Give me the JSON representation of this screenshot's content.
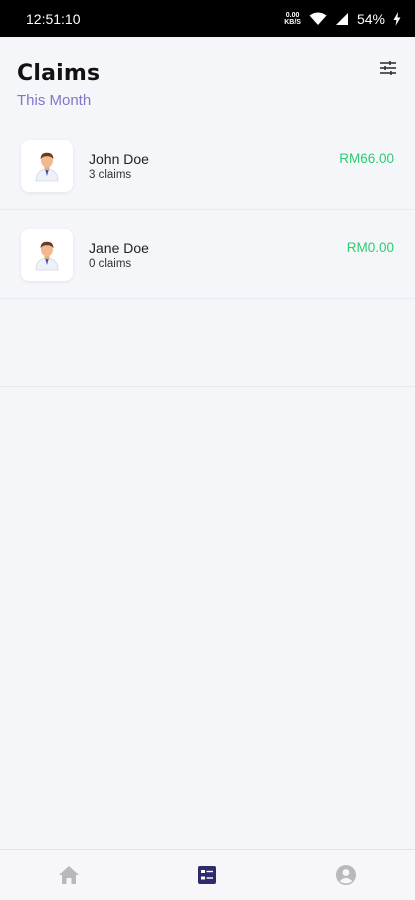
{
  "status_bar": {
    "time": "12:51:10",
    "net_speed_value": "0.00",
    "net_speed_unit": "KB/S",
    "battery": "54%"
  },
  "header": {
    "title": "Claims",
    "subtitle": "This Month",
    "filter_icon": "tune-icon"
  },
  "claims": [
    {
      "name": "John Doe",
      "count": "3 claims",
      "amount": "RM66.00"
    },
    {
      "name": "Jane Doe",
      "count": "0 claims",
      "amount": "RM0.00"
    }
  ],
  "bottom_nav": {
    "items": [
      {
        "icon": "home-icon",
        "active": false
      },
      {
        "icon": "claims-list-icon",
        "active": true
      },
      {
        "icon": "profile-icon",
        "active": false
      }
    ]
  },
  "colors": {
    "accent": "#2d2b6e",
    "subtitle": "#7b78c9",
    "amount": "#2ecc71",
    "inactive_icon": "#b9b9bd"
  }
}
